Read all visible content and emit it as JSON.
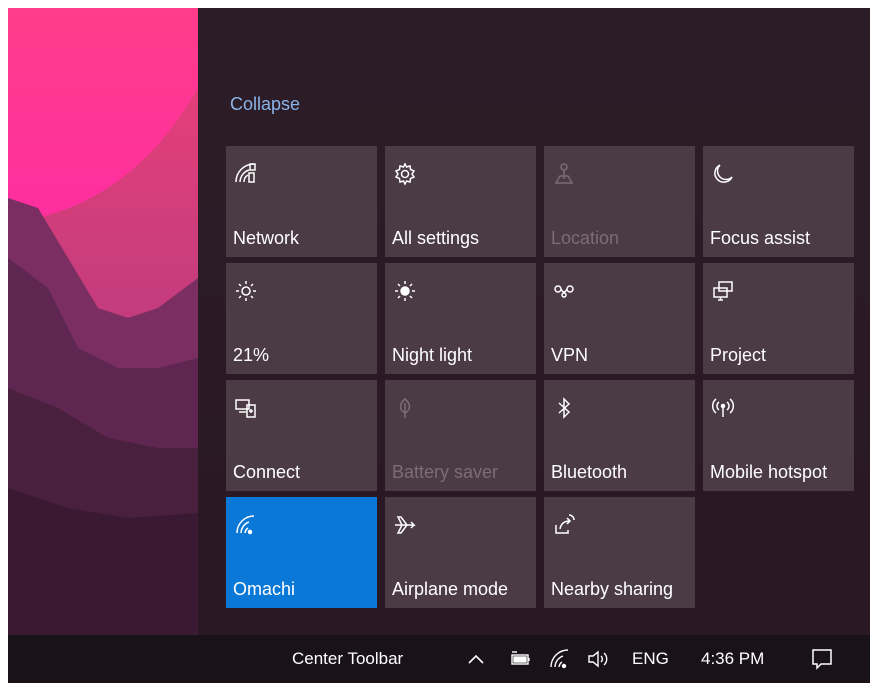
{
  "action_center": {
    "collapse_label": "Collapse",
    "tiles": [
      {
        "label": "Network",
        "icon": "network-icon",
        "state": "normal"
      },
      {
        "label": "All settings",
        "icon": "gear-icon",
        "state": "normal"
      },
      {
        "label": "Location",
        "icon": "location-icon",
        "state": "disabled"
      },
      {
        "label": "Focus assist",
        "icon": "moon-icon",
        "state": "normal"
      },
      {
        "label": "21%",
        "icon": "brightness-icon",
        "state": "normal"
      },
      {
        "label": "Night light",
        "icon": "night-light-icon",
        "state": "normal"
      },
      {
        "label": "VPN",
        "icon": "vpn-icon",
        "state": "normal"
      },
      {
        "label": "Project",
        "icon": "project-icon",
        "state": "normal"
      },
      {
        "label": "Connect",
        "icon": "connect-icon",
        "state": "normal"
      },
      {
        "label": "Battery saver",
        "icon": "leaf-icon",
        "state": "disabled"
      },
      {
        "label": "Bluetooth",
        "icon": "bluetooth-icon",
        "state": "normal"
      },
      {
        "label": "Mobile hotspot",
        "icon": "hotspot-icon",
        "state": "normal"
      },
      {
        "label": "Omachi",
        "icon": "wifi-icon",
        "state": "active"
      },
      {
        "label": "Airplane mode",
        "icon": "airplane-icon",
        "state": "normal"
      },
      {
        "label": "Nearby sharing",
        "icon": "share-icon",
        "state": "normal"
      }
    ]
  },
  "taskbar": {
    "toolbar_label": "Center Toolbar",
    "language": "ENG",
    "time": "4:36 PM",
    "tray_icons": [
      "chevron-up-icon",
      "battery-icon",
      "wifi-icon",
      "volume-icon"
    ],
    "notification_icon": "action-center-icon"
  },
  "colors": {
    "tile": "#4b3b44",
    "tile_active": "#0a78d6",
    "panel": "#2b1b26",
    "taskbar": "#191319",
    "link": "#8ab4e8",
    "disabled_text": "#7d6c76"
  }
}
